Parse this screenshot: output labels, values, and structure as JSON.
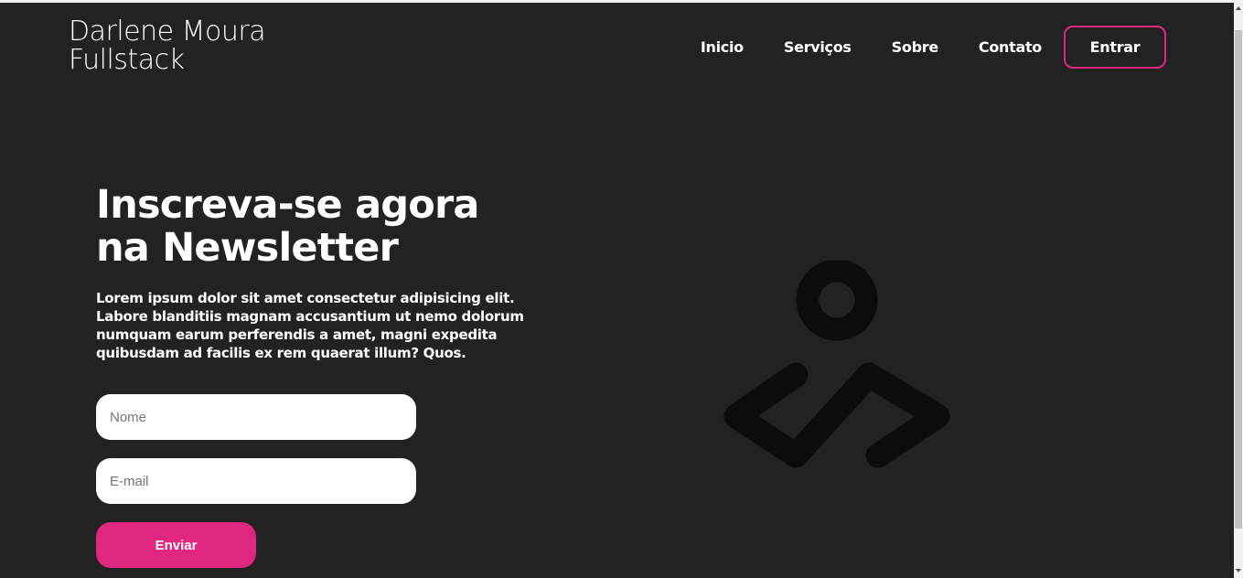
{
  "header": {
    "logo_line1": "Darlene Moura",
    "logo_line2": "Fullstack",
    "nav": {
      "inicio": "Inicio",
      "servicos": "Serviços",
      "sobre": "Sobre",
      "contato": "Contato"
    },
    "login_label": "Entrar"
  },
  "hero": {
    "title_line1": "Inscreva-se agora",
    "title_line2": "na Newsletter",
    "description": "Lorem ipsum dolor sit amet consectetur adipisicing elit. Labore blanditiis magnam accusantium ut nemo dolorum numquam earum perferendis a amet, magni expedita quibusdam ad facilis ex rem quaerat illum? Quos."
  },
  "form": {
    "name_placeholder": "Nome",
    "email_placeholder": "E-mail",
    "submit_label": "Enviar"
  },
  "colors": {
    "background": "#222222",
    "accent": "#e0267f",
    "text": "#ffffff",
    "illustration": "#0c0c0c"
  },
  "icons": {
    "illustration": "person-code-logo-icon"
  }
}
